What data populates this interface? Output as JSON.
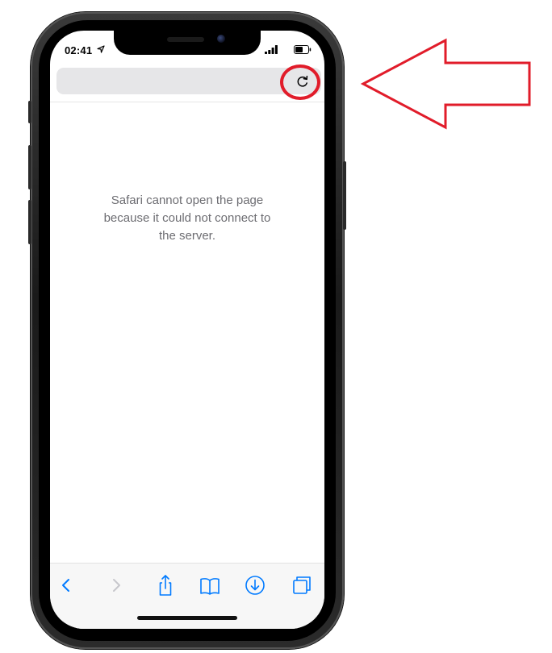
{
  "status_bar": {
    "time": "02:41",
    "icons": [
      "location-arrow-icon",
      "signal-icon",
      "battery-icon"
    ]
  },
  "browser": {
    "app": "Safari",
    "address_bar": {
      "value": ""
    },
    "reload_icon": "reload-icon"
  },
  "error": {
    "message": "Safari cannot open the page\nbecause it could not connect to\nthe server."
  },
  "toolbar": {
    "buttons": [
      {
        "name": "back",
        "icon": "chevron-left-icon",
        "enabled": true
      },
      {
        "name": "forward",
        "icon": "chevron-right-icon",
        "enabled": false
      },
      {
        "name": "share",
        "icon": "share-icon",
        "enabled": true
      },
      {
        "name": "bookmarks",
        "icon": "book-icon",
        "enabled": true
      },
      {
        "name": "downloads",
        "icon": "download-icon",
        "enabled": true
      },
      {
        "name": "tabs",
        "icon": "tabs-icon",
        "enabled": true
      }
    ]
  },
  "colors": {
    "ios_blue": "#007aff",
    "disabled_gray": "#c7c7cc",
    "annotation_red": "#e11c2a",
    "error_text": "#6d6d72"
  },
  "annotations": [
    "highlight-circle",
    "pointer-arrow"
  ]
}
